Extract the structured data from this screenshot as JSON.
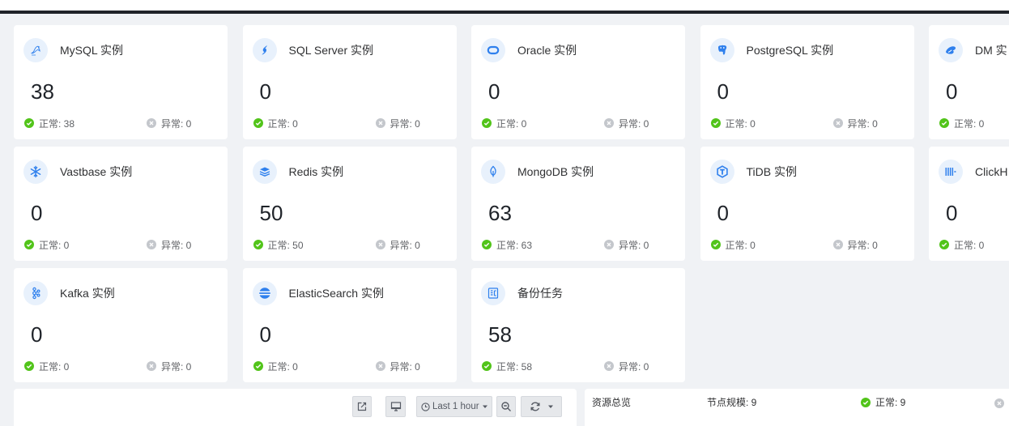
{
  "colors": {
    "page_bg": "#f0f2f5",
    "top_bar": "#1f2329",
    "accent": "#2f80ed",
    "icon_bg": "#e8f1fc",
    "normal": "#52c41a",
    "abnormal": "#c4c7cc"
  },
  "cards": [
    {
      "icon": "mysql-icon",
      "title": "MySQL 实例",
      "value": 38,
      "normal": "正常: 38",
      "abnormal": "异常: 0"
    },
    {
      "icon": "sqlserver-icon",
      "title": "SQL Server 实例",
      "value": 0,
      "normal": "正常: 0",
      "abnormal": "异常: 0"
    },
    {
      "icon": "oracle-icon",
      "title": "Oracle 实例",
      "value": 0,
      "normal": "正常: 0",
      "abnormal": "异常: 0"
    },
    {
      "icon": "postgresql-icon",
      "title": "PostgreSQL 实例",
      "value": 0,
      "normal": "正常: 0",
      "abnormal": "异常: 0"
    },
    {
      "icon": "dm-icon",
      "title": "DM 实",
      "value": 0,
      "normal": "正常: 0"
    },
    {
      "icon": "vastbase-icon",
      "title": "Vastbase 实例",
      "value": 0,
      "normal": "正常: 0",
      "abnormal": "异常: 0"
    },
    {
      "icon": "redis-icon",
      "title": "Redis 实例",
      "value": 50,
      "normal": "正常: 50",
      "abnormal": "异常: 0"
    },
    {
      "icon": "mongodb-icon",
      "title": "MongoDB 实例",
      "value": 63,
      "normal": "正常: 63",
      "abnormal": "异常: 0"
    },
    {
      "icon": "tidb-icon",
      "title": "TiDB 实例",
      "value": 0,
      "normal": "正常: 0",
      "abnormal": "异常: 0"
    },
    {
      "icon": "clickhouse-icon",
      "title": "ClickH",
      "value": 0,
      "normal": "正常: 0"
    },
    {
      "icon": "kafka-icon",
      "title": "Kafka 实例",
      "value": 0,
      "normal": "正常: 0",
      "abnormal": "异常: 0"
    },
    {
      "icon": "elasticsearch-icon",
      "title": "ElasticSearch 实例",
      "value": 0,
      "normal": "正常: 0",
      "abnormal": "异常: 0"
    },
    {
      "icon": "backup-task-icon",
      "title": "备份任务",
      "value": 58,
      "normal": "正常: 58",
      "abnormal": "异常: 0"
    }
  ],
  "toolbar": {
    "icons": [
      "share-icon",
      "monitor-icon",
      "clock-icon",
      "caret-down-icon",
      "zoom-out-icon",
      "refresh-icon"
    ],
    "time_range": "Last 1 hour"
  },
  "overview": {
    "title": "资源总览",
    "node_scale": "节点规模: 9",
    "normal": "正常: 9",
    "icons": [
      "check-circle-icon",
      "close-circle-icon"
    ]
  }
}
